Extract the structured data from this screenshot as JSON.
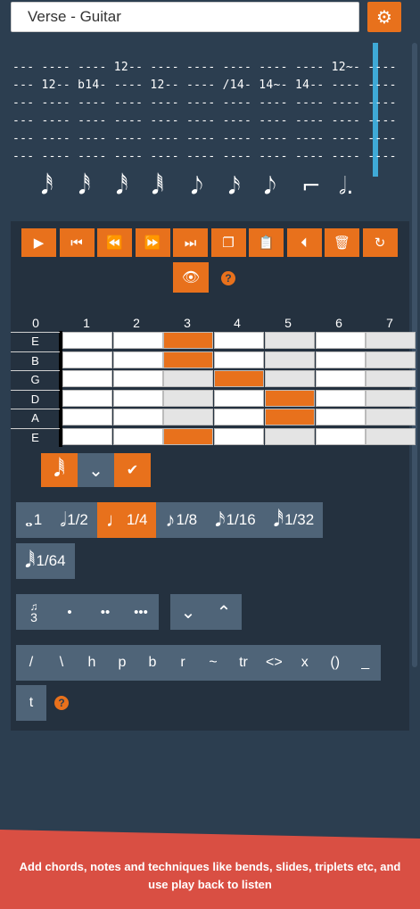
{
  "header": {
    "title_value": "Verse - Guitar",
    "settings_icon": "gear-icon"
  },
  "tab": {
    "lines": [
      "--- ---- ---- 12-- ---- ---- ---- ---- ---- 12~- ----",
      "--- 12-- b14- ---- 12-- ---- /14- 14~- 14-- ---- ----",
      "--- ---- ---- ---- ---- ---- ---- ---- ---- ---- ----",
      "--- ---- ---- ---- ---- ---- ---- ---- ---- ---- ----",
      "--- ---- ---- ---- ---- ---- ---- ---- ---- ---- ----",
      "--- ---- ---- ---- ---- ---- ---- ---- ---- ---- ----"
    ],
    "note_glyphs": [
      "𝅘𝅥𝅰",
      "𝅘𝅥𝅰",
      "𝅘𝅥𝅰",
      "𝅘𝅥𝅱",
      "𝅘𝅥𝅮",
      "𝅘𝅥𝅯",
      "𝅘𝅥𝅮",
      "⌐",
      "𝅗𝅥."
    ]
  },
  "controls": {
    "buttons": [
      {
        "name": "play-button",
        "icon": "▶"
      },
      {
        "name": "skip-start-button",
        "icon": "⏮"
      },
      {
        "name": "rewind-button",
        "icon": "⏪"
      },
      {
        "name": "forward-button",
        "icon": "⏩"
      },
      {
        "name": "skip-end-button",
        "icon": "⏭"
      },
      {
        "name": "copy-button",
        "icon": "❐"
      },
      {
        "name": "paste-button",
        "icon": "📋"
      },
      {
        "name": "step-back-button",
        "icon": "⏴"
      },
      {
        "name": "delete-button",
        "icon": "🗑"
      },
      {
        "name": "reset-button",
        "icon": "↻"
      }
    ],
    "eye_icon": "👁",
    "help": "?"
  },
  "fretboard": {
    "fret_numbers": [
      "0",
      "1",
      "2",
      "3",
      "4",
      "5",
      "6",
      "7"
    ],
    "strings": [
      "E",
      "B",
      "G",
      "D",
      "A",
      "E"
    ],
    "selected": [
      {
        "string": 0,
        "fret": 3
      },
      {
        "string": 1,
        "fret": 3
      },
      {
        "string": 2,
        "fret": 4
      },
      {
        "string": 3,
        "fret": 5
      },
      {
        "string": 4,
        "fret": 5
      },
      {
        "string": 5,
        "fret": 3
      }
    ]
  },
  "selector": {
    "note_icon": "𝅘𝅥𝅱",
    "dropdown_icon": "⌄",
    "confirm_icon": "✔"
  },
  "durations": {
    "items": [
      {
        "glyph": "𝅝",
        "label": "1"
      },
      {
        "glyph": "𝅗𝅥",
        "label": "1/2"
      },
      {
        "glyph": "♩",
        "label": "1/4",
        "active": true
      },
      {
        "glyph": "♪",
        "label": "1/8"
      },
      {
        "glyph": "𝅘𝅥𝅯",
        "label": "1/16"
      },
      {
        "glyph": "𝅘𝅥𝅰",
        "label": "1/32"
      }
    ],
    "last": {
      "glyph": "𝅘𝅥𝅱",
      "label": "1/64"
    }
  },
  "modifiers": {
    "triplet_label": "3",
    "dots": [
      "•",
      "••",
      "•••"
    ],
    "down_icon": "⌄",
    "up_icon": "⌃"
  },
  "techniques": {
    "items": [
      "/",
      "\\",
      "h",
      "p",
      "b",
      "r",
      "~",
      "tr",
      "<>",
      "x",
      "()",
      "_"
    ],
    "extra": "t",
    "help": "?"
  },
  "banner": {
    "text": "Add chords, notes and techniques like bends, slides, triplets etc, and use play back to listen"
  },
  "colors": {
    "accent": "#e8711c",
    "background": "#2c3e50",
    "cursor": "#3fa9d6",
    "banner": "#d94f43"
  }
}
